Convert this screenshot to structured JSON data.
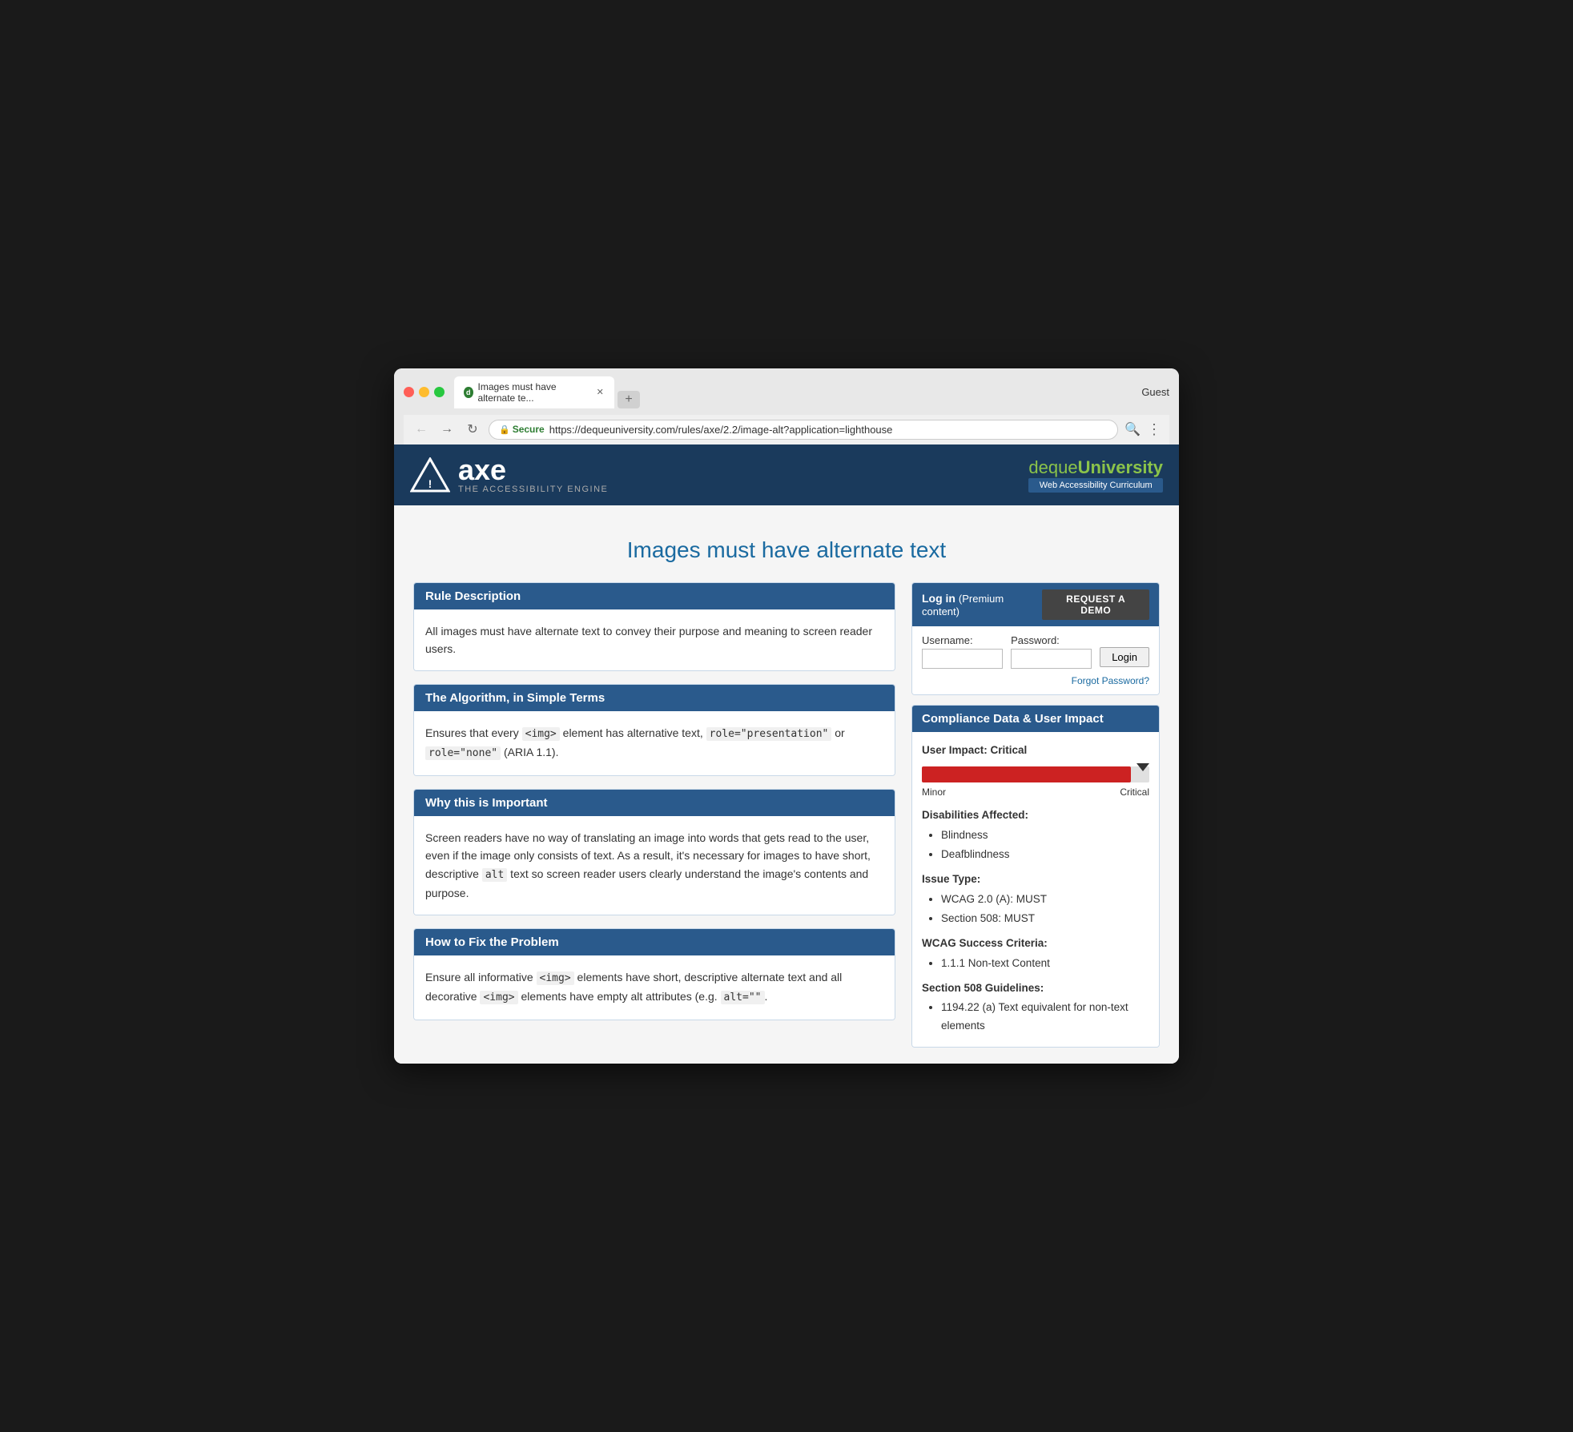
{
  "browser": {
    "tab_title": "Images must have alternate te...",
    "guest_label": "Guest",
    "url_secure_label": "Secure",
    "url": "https://dequeuniversity.com/rules/axe/2.2/image-alt?application=lighthouse",
    "nav": {
      "back": "←",
      "forward": "→",
      "reload": "↻"
    }
  },
  "header": {
    "logo_tagline": "THE ACCESSIBILITY ENGINE",
    "axe_text": "axe",
    "deque_name_first": "deque",
    "deque_name_second": "University",
    "curriculum_label": "Web Accessibility Curriculum"
  },
  "page": {
    "title": "Images must have alternate text"
  },
  "login_panel": {
    "log_in_label": "Log in",
    "premium_label": "(Premium content)",
    "request_demo_btn": "REQUEST A DEMO",
    "username_label": "Username:",
    "password_label": "Password:",
    "username_value": "",
    "password_value": "",
    "login_btn": "Login",
    "forgot_password": "Forgot Password?"
  },
  "rule_description": {
    "header": "Rule Description",
    "body": "All images must have alternate text to convey their purpose and meaning to screen reader users."
  },
  "algorithm": {
    "header": "The Algorithm, in Simple Terms",
    "body_pre": "Ensures that every ",
    "code1": "<img>",
    "body_mid": " element has alternative text, ",
    "code2": "role=\"presentation\"",
    "body_mid2": " or ",
    "code3": "role=\"none\"",
    "body_post": " (ARIA 1.1)."
  },
  "why_important": {
    "header": "Why this is Important",
    "body_pre": "Screen readers have no way of translating an image into words that gets read to the user, even if the image only consists of text. As a result, it's necessary for images to have short, descriptive ",
    "code_alt": "alt",
    "body_post": " text so screen reader users clearly understand the image's contents and purpose."
  },
  "how_to_fix": {
    "header": "How to Fix the Problem",
    "body_pre": "Ensure all informative ",
    "code1": "<img>",
    "body_mid": " elements have short, descriptive alternate text and all decorative ",
    "code2": "<img>",
    "body_mid2": " elements have empty alt attributes (e.g. ",
    "code3": "alt=\"\"",
    "body_post": "."
  },
  "compliance": {
    "header": "Compliance Data & User Impact",
    "user_impact_label": "User Impact: Critical",
    "impact_minor": "Minor",
    "impact_critical": "Critical",
    "disabilities_label": "Disabilities Affected:",
    "disabilities": [
      "Blindness",
      "Deafblindness"
    ],
    "issue_type_label": "Issue Type:",
    "issue_types": [
      "WCAG 2.0 (A): MUST",
      "Section 508: MUST"
    ],
    "wcag_label": "WCAG Success Criteria:",
    "wcag_items": [
      "1.1.1 Non-text Content"
    ],
    "section508_label": "Section 508 Guidelines:",
    "section508_items": [
      "1194.22 (a) Text equivalent for non-text elements"
    ]
  }
}
